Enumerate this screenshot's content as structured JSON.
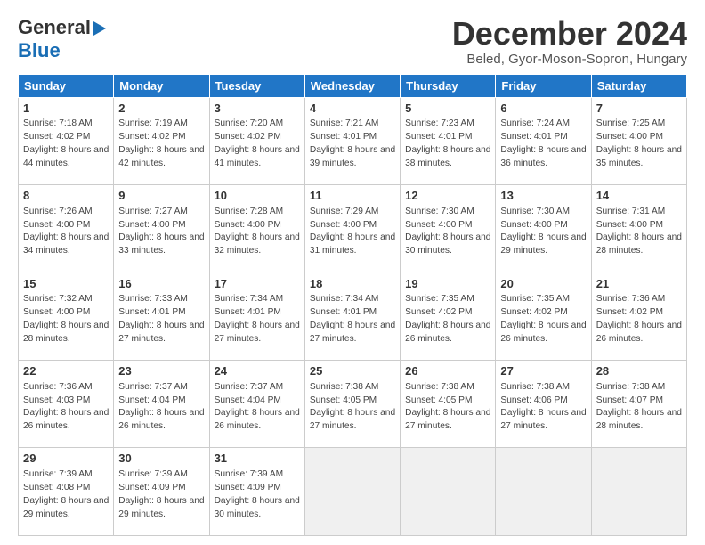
{
  "logo": {
    "line1": "General",
    "line2": "Blue"
  },
  "title": "December 2024",
  "subtitle": "Beled, Gyor-Moson-Sopron, Hungary",
  "weekdays": [
    "Sunday",
    "Monday",
    "Tuesday",
    "Wednesday",
    "Thursday",
    "Friday",
    "Saturday"
  ],
  "weeks": [
    [
      {
        "day": 1,
        "sunrise": "7:18 AM",
        "sunset": "4:02 PM",
        "daylight": "8 hours and 44 minutes."
      },
      {
        "day": 2,
        "sunrise": "7:19 AM",
        "sunset": "4:02 PM",
        "daylight": "8 hours and 42 minutes."
      },
      {
        "day": 3,
        "sunrise": "7:20 AM",
        "sunset": "4:02 PM",
        "daylight": "8 hours and 41 minutes."
      },
      {
        "day": 4,
        "sunrise": "7:21 AM",
        "sunset": "4:01 PM",
        "daylight": "8 hours and 39 minutes."
      },
      {
        "day": 5,
        "sunrise": "7:23 AM",
        "sunset": "4:01 PM",
        "daylight": "8 hours and 38 minutes."
      },
      {
        "day": 6,
        "sunrise": "7:24 AM",
        "sunset": "4:01 PM",
        "daylight": "8 hours and 36 minutes."
      },
      {
        "day": 7,
        "sunrise": "7:25 AM",
        "sunset": "4:00 PM",
        "daylight": "8 hours and 35 minutes."
      }
    ],
    [
      {
        "day": 8,
        "sunrise": "7:26 AM",
        "sunset": "4:00 PM",
        "daylight": "8 hours and 34 minutes."
      },
      {
        "day": 9,
        "sunrise": "7:27 AM",
        "sunset": "4:00 PM",
        "daylight": "8 hours and 33 minutes."
      },
      {
        "day": 10,
        "sunrise": "7:28 AM",
        "sunset": "4:00 PM",
        "daylight": "8 hours and 32 minutes."
      },
      {
        "day": 11,
        "sunrise": "7:29 AM",
        "sunset": "4:00 PM",
        "daylight": "8 hours and 31 minutes."
      },
      {
        "day": 12,
        "sunrise": "7:30 AM",
        "sunset": "4:00 PM",
        "daylight": "8 hours and 30 minutes."
      },
      {
        "day": 13,
        "sunrise": "7:30 AM",
        "sunset": "4:00 PM",
        "daylight": "8 hours and 29 minutes."
      },
      {
        "day": 14,
        "sunrise": "7:31 AM",
        "sunset": "4:00 PM",
        "daylight": "8 hours and 28 minutes."
      }
    ],
    [
      {
        "day": 15,
        "sunrise": "7:32 AM",
        "sunset": "4:00 PM",
        "daylight": "8 hours and 28 minutes."
      },
      {
        "day": 16,
        "sunrise": "7:33 AM",
        "sunset": "4:01 PM",
        "daylight": "8 hours and 27 minutes."
      },
      {
        "day": 17,
        "sunrise": "7:34 AM",
        "sunset": "4:01 PM",
        "daylight": "8 hours and 27 minutes."
      },
      {
        "day": 18,
        "sunrise": "7:34 AM",
        "sunset": "4:01 PM",
        "daylight": "8 hours and 27 minutes."
      },
      {
        "day": 19,
        "sunrise": "7:35 AM",
        "sunset": "4:02 PM",
        "daylight": "8 hours and 26 minutes."
      },
      {
        "day": 20,
        "sunrise": "7:35 AM",
        "sunset": "4:02 PM",
        "daylight": "8 hours and 26 minutes."
      },
      {
        "day": 21,
        "sunrise": "7:36 AM",
        "sunset": "4:02 PM",
        "daylight": "8 hours and 26 minutes."
      }
    ],
    [
      {
        "day": 22,
        "sunrise": "7:36 AM",
        "sunset": "4:03 PM",
        "daylight": "8 hours and 26 minutes."
      },
      {
        "day": 23,
        "sunrise": "7:37 AM",
        "sunset": "4:04 PM",
        "daylight": "8 hours and 26 minutes."
      },
      {
        "day": 24,
        "sunrise": "7:37 AM",
        "sunset": "4:04 PM",
        "daylight": "8 hours and 26 minutes."
      },
      {
        "day": 25,
        "sunrise": "7:38 AM",
        "sunset": "4:05 PM",
        "daylight": "8 hours and 27 minutes."
      },
      {
        "day": 26,
        "sunrise": "7:38 AM",
        "sunset": "4:05 PM",
        "daylight": "8 hours and 27 minutes."
      },
      {
        "day": 27,
        "sunrise": "7:38 AM",
        "sunset": "4:06 PM",
        "daylight": "8 hours and 27 minutes."
      },
      {
        "day": 28,
        "sunrise": "7:38 AM",
        "sunset": "4:07 PM",
        "daylight": "8 hours and 28 minutes."
      }
    ],
    [
      {
        "day": 29,
        "sunrise": "7:39 AM",
        "sunset": "4:08 PM",
        "daylight": "8 hours and 29 minutes."
      },
      {
        "day": 30,
        "sunrise": "7:39 AM",
        "sunset": "4:09 PM",
        "daylight": "8 hours and 29 minutes."
      },
      {
        "day": 31,
        "sunrise": "7:39 AM",
        "sunset": "4:09 PM",
        "daylight": "8 hours and 30 minutes."
      },
      null,
      null,
      null,
      null
    ]
  ]
}
